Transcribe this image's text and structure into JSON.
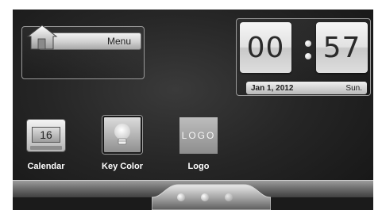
{
  "menu": {
    "label": "Menu",
    "icon": "home-icon"
  },
  "clock": {
    "hours": "00",
    "minutes": "57",
    "date": "Jan 1, 2012",
    "weekday": "Sun."
  },
  "apps": [
    {
      "label": "Calendar",
      "icon": "calendar-icon",
      "day": "16"
    },
    {
      "label": "Key Color",
      "icon": "bulb-icon"
    },
    {
      "label": "Logo",
      "icon": "logo-icon",
      "logo_text": "LOGO"
    }
  ],
  "pager": {
    "pages": 3,
    "current_page": 3
  }
}
